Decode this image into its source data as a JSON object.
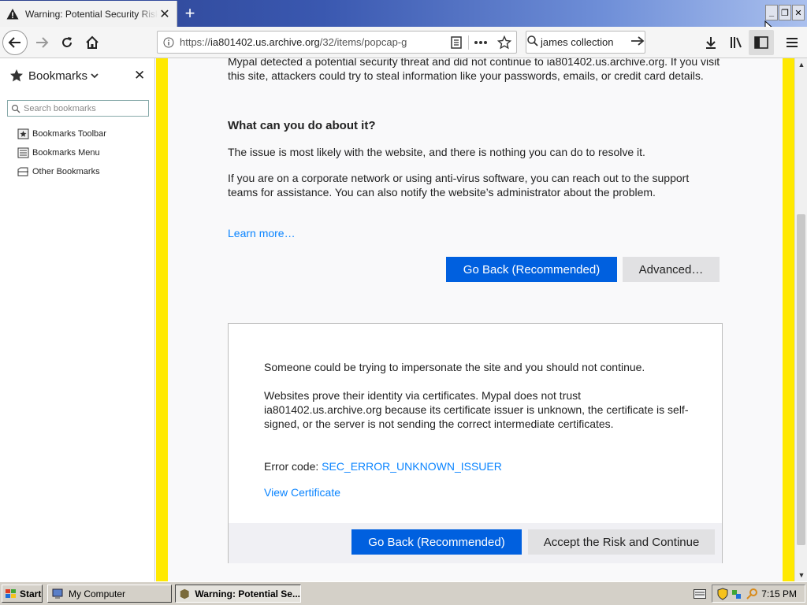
{
  "tab": {
    "title": "Warning: Potential Security Risk Ahead",
    "close": "✕"
  },
  "newtab": "+",
  "window_controls": {
    "minimize": "_",
    "restore": "❐",
    "close": "✕"
  },
  "urlbar": {
    "url_prefix": "https://",
    "url_host": "ia801402.us.archive.org",
    "url_path": "/32/items/popcap-g"
  },
  "searchbar": {
    "value": "james collection"
  },
  "sidebar": {
    "title": "Bookmarks",
    "close": "✕",
    "search_placeholder": "Search bookmarks",
    "items": [
      {
        "label": "Bookmarks Toolbar",
        "icon": "star-folder-icon"
      },
      {
        "label": "Bookmarks Menu",
        "icon": "menu-list-icon"
      },
      {
        "label": "Other Bookmarks",
        "icon": "folder-icon"
      }
    ]
  },
  "content": {
    "intro": "Mypal detected a potential security threat and did not continue to ia801402.us.archive.org. If you visit this site, attackers could try to steal information like your passwords, emails, or credit card details.",
    "heading": "What can you do about it?",
    "para1": "The issue is most likely with the website, and there is nothing you can do to resolve it.",
    "para2": "If you are on a corporate network or using anti-virus software, you can reach out to the support teams for assistance. You can also notify the website’s administrator about the problem.",
    "learn_more": "Learn more…",
    "go_back": "Go Back (Recommended)",
    "advanced": "Advanced…",
    "panel": {
      "impersonate": "Someone could be trying to impersonate the site and you should not continue.",
      "cert_explain": "Websites prove their identity via certificates. Mypal does not trust ia801402.us.archive.org because its certificate issuer is unknown, the certificate is self-signed, or the server is not sending the correct intermediate certificates.",
      "error_code_label": "Error code:",
      "error_code": "SEC_ERROR_UNKNOWN_ISSUER",
      "view_certificate": "View Certificate",
      "go_back": "Go Back (Recommended)",
      "accept": "Accept the Risk and Continue"
    }
  },
  "taskbar": {
    "start": "Start",
    "items": [
      {
        "label": "My Computer"
      },
      {
        "label": "Warning: Potential Se..."
      }
    ],
    "clock": "7:15 PM"
  },
  "colors": {
    "accent": "#0060df",
    "link": "#0a84ff",
    "warning_border": "#ffe900",
    "titlebar": "#3a58b0"
  }
}
